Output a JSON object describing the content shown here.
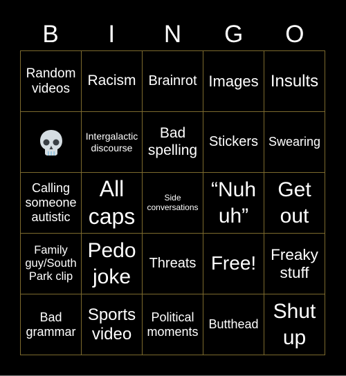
{
  "header": {
    "letters": [
      "B",
      "I",
      "N",
      "G",
      "O"
    ]
  },
  "board": {
    "rows": [
      [
        {
          "text": "Random videos"
        },
        {
          "text": "Racism"
        },
        {
          "text": "Brainrot"
        },
        {
          "text": "Images"
        },
        {
          "text": "Insults"
        }
      ],
      [
        {
          "text": "💀",
          "icon": "skull-icon"
        },
        {
          "text": "Intergalactic discourse"
        },
        {
          "text": "Bad spelling"
        },
        {
          "text": "Stickers"
        },
        {
          "text": "Swearing"
        }
      ],
      [
        {
          "text": "Calling someone autistic"
        },
        {
          "text": "All caps"
        },
        {
          "text": "Side conversations"
        },
        {
          "text": "“Nuh uh”"
        },
        {
          "text": "Get out"
        }
      ],
      [
        {
          "text": "Family guy/South Park clip"
        },
        {
          "text": "Pedo joke"
        },
        {
          "text": "Threats"
        },
        {
          "text": "Free!"
        },
        {
          "text": "Freaky stuff"
        }
      ],
      [
        {
          "text": "Bad grammar"
        },
        {
          "text": "Sports video"
        },
        {
          "text": "Political moments"
        },
        {
          "text": "Butthead"
        },
        {
          "text": "Shut up"
        }
      ]
    ]
  },
  "colors": {
    "background": "#000000",
    "text": "#ffffff",
    "grid_line": "#7d6b2e"
  }
}
